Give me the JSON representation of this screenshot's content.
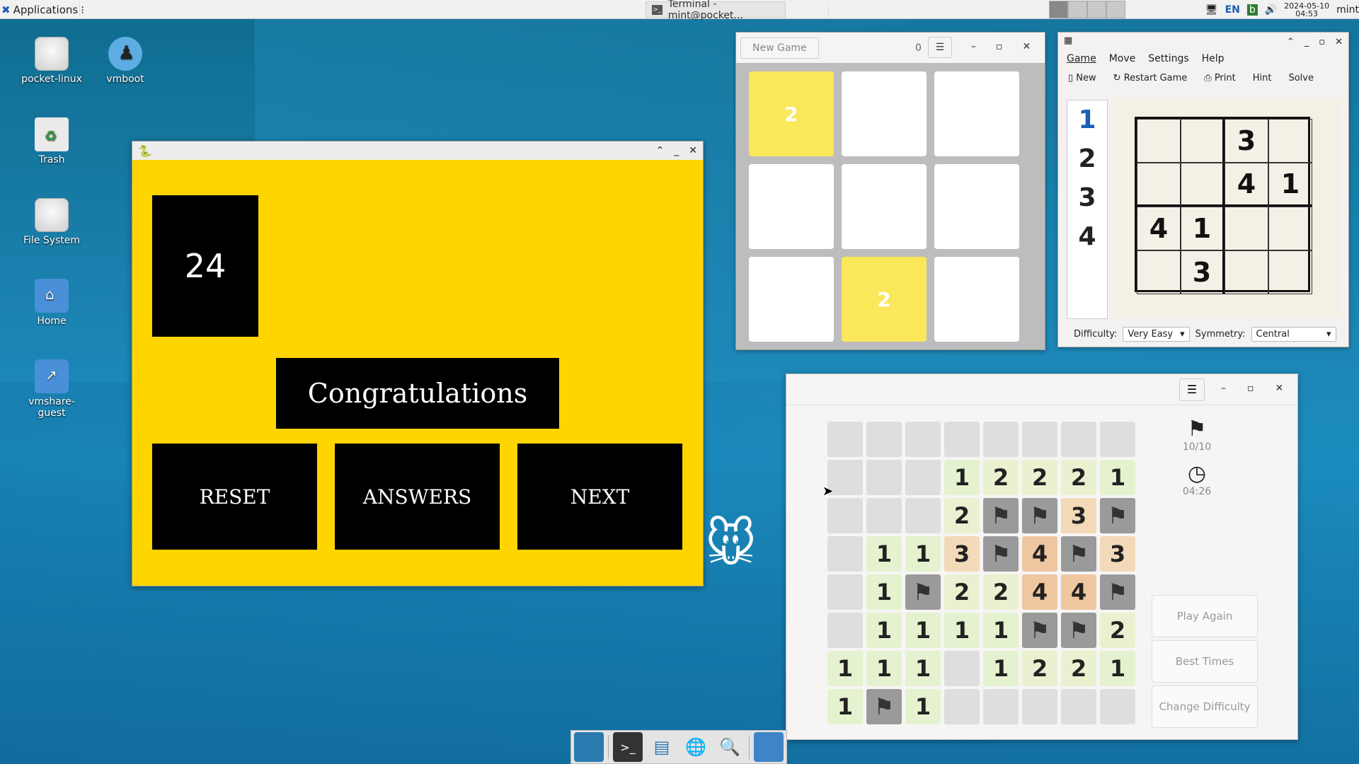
{
  "top_panel": {
    "applications": "Applications",
    "task_label": "Terminal - mint@pocket...",
    "lang": "EN",
    "date": "2024-05-10",
    "time": "04:53",
    "user": "mint"
  },
  "desktop_icons": [
    {
      "label": "pocket-linux"
    },
    {
      "label": "vmboot"
    },
    {
      "label": "Trash"
    },
    {
      "label": "File System"
    },
    {
      "label": "Home"
    },
    {
      "label": "vmshare-guest"
    }
  ],
  "game24": {
    "number": "24",
    "message": "Congratulations",
    "buttons": [
      "RESET",
      "ANSWERS",
      "NEXT"
    ],
    "bg_color": "#ffd500"
  },
  "game2048": {
    "new_game": "New Game",
    "score": "0",
    "tiles": [
      "2",
      "",
      "",
      "",
      "",
      "",
      "",
      "2",
      ""
    ]
  },
  "sudoku": {
    "menus": [
      "Game",
      "Move",
      "Settings",
      "Help"
    ],
    "tools": [
      "New",
      "Restart Game",
      "Print",
      "Hint",
      "Solve"
    ],
    "palette": [
      "1",
      "2",
      "3",
      "4"
    ],
    "grid": [
      "",
      "",
      "3",
      "",
      "",
      "",
      "4",
      "1",
      "4",
      "1",
      "",
      "",
      "",
      "3",
      "",
      ""
    ],
    "difficulty_label": "Difficulty:",
    "difficulty_value": "Very Easy",
    "symmetry_label": "Symmetry:",
    "symmetry_value": "Central"
  },
  "mines": {
    "flags": "10/10",
    "time": "04:26",
    "buttons": [
      "Play Again",
      "Best Times",
      "Change Difficulty"
    ],
    "grid": [
      [
        "u",
        "u",
        "u",
        "u",
        "u",
        "u",
        "u",
        "u"
      ],
      [
        "u",
        "u",
        "u",
        "1",
        "2",
        "2",
        "2",
        "1"
      ],
      [
        "u",
        "u",
        "u",
        "2",
        "F",
        "F",
        "3",
        "F"
      ],
      [
        "u",
        "1",
        "1",
        "3",
        "F",
        "4",
        "F",
        "3"
      ],
      [
        "u",
        "1",
        "F",
        "2",
        "2",
        "4",
        "4",
        "F"
      ],
      [
        "u",
        "1",
        "1",
        "1",
        "1",
        "F",
        "F",
        "2"
      ],
      [
        "1",
        "1",
        "1",
        "u",
        "1",
        "2",
        "2",
        "1"
      ],
      [
        "1",
        "F",
        "1",
        "u",
        "u",
        "u",
        "u",
        "u"
      ]
    ]
  }
}
